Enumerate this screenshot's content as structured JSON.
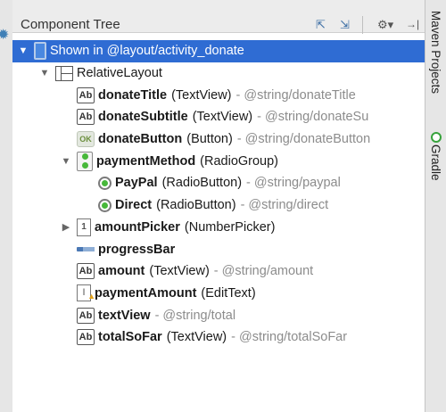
{
  "panel": {
    "title": "Component Tree",
    "toolbar": {
      "expand_icon": "expand-all-icon",
      "collapse_icon": "collapse-all-icon",
      "settings_icon": "gear-icon",
      "hide_icon": "hide-panel-icon"
    }
  },
  "side_tabs": {
    "maven": "Maven Projects",
    "gradle": "Gradle"
  },
  "colors": {
    "selection": "#2f6cd3",
    "reference": "#8c8c8c",
    "radio_dot": "#47b83a"
  },
  "tree": [
    {
      "indent": 0,
      "arrow": "▼",
      "icon": "device-icon",
      "name": "",
      "type": "Shown in @layout/activity_donate",
      "ref": "",
      "selected": true
    },
    {
      "indent": 1,
      "arrow": "▼",
      "icon": "relative-layout-icon",
      "name": "",
      "type": "RelativeLayout",
      "ref": ""
    },
    {
      "indent": 2,
      "arrow": "",
      "icon": "textview-icon",
      "name": "donateTitle",
      "type": "(TextView)",
      "ref": "- @string/donateTitle"
    },
    {
      "indent": 2,
      "arrow": "",
      "icon": "textview-icon",
      "name": "donateSubtitle",
      "type": "(TextView)",
      "ref": "- @string/donateSu"
    },
    {
      "indent": 2,
      "arrow": "",
      "icon": "button-icon",
      "name": "donateButton",
      "type": "(Button)",
      "ref": "- @string/donateButton"
    },
    {
      "indent": 2,
      "arrow": "▼",
      "icon": "radiogroup-icon",
      "name": "paymentMethod",
      "type": "(RadioGroup)",
      "ref": ""
    },
    {
      "indent": 3,
      "arrow": "",
      "icon": "radiobutton-icon",
      "name": "PayPal",
      "type": "(RadioButton)",
      "ref": "- @string/paypal"
    },
    {
      "indent": 3,
      "arrow": "",
      "icon": "radiobutton-icon",
      "name": "Direct",
      "type": "(RadioButton)",
      "ref": "- @string/direct"
    },
    {
      "indent": 2,
      "arrow": "▶",
      "icon": "numberpicker-icon",
      "name": "amountPicker",
      "type": "(NumberPicker)",
      "ref": ""
    },
    {
      "indent": 2,
      "arrow": "",
      "icon": "progressbar-icon",
      "name": "progressBar",
      "type": "",
      "ref": ""
    },
    {
      "indent": 2,
      "arrow": "",
      "icon": "textview-icon",
      "name": "amount",
      "type": "(TextView)",
      "ref": "- @string/amount"
    },
    {
      "indent": 2,
      "arrow": "",
      "icon": "edittext-warning-icon",
      "name": "paymentAmount",
      "type": "(EditText)",
      "ref": ""
    },
    {
      "indent": 2,
      "arrow": "",
      "icon": "textview-icon",
      "name": "textView",
      "type": "",
      "ref": "- @string/total"
    },
    {
      "indent": 2,
      "arrow": "",
      "icon": "textview-icon",
      "name": "totalSoFar",
      "type": "(TextView)",
      "ref": "- @string/totalSoFar"
    }
  ]
}
